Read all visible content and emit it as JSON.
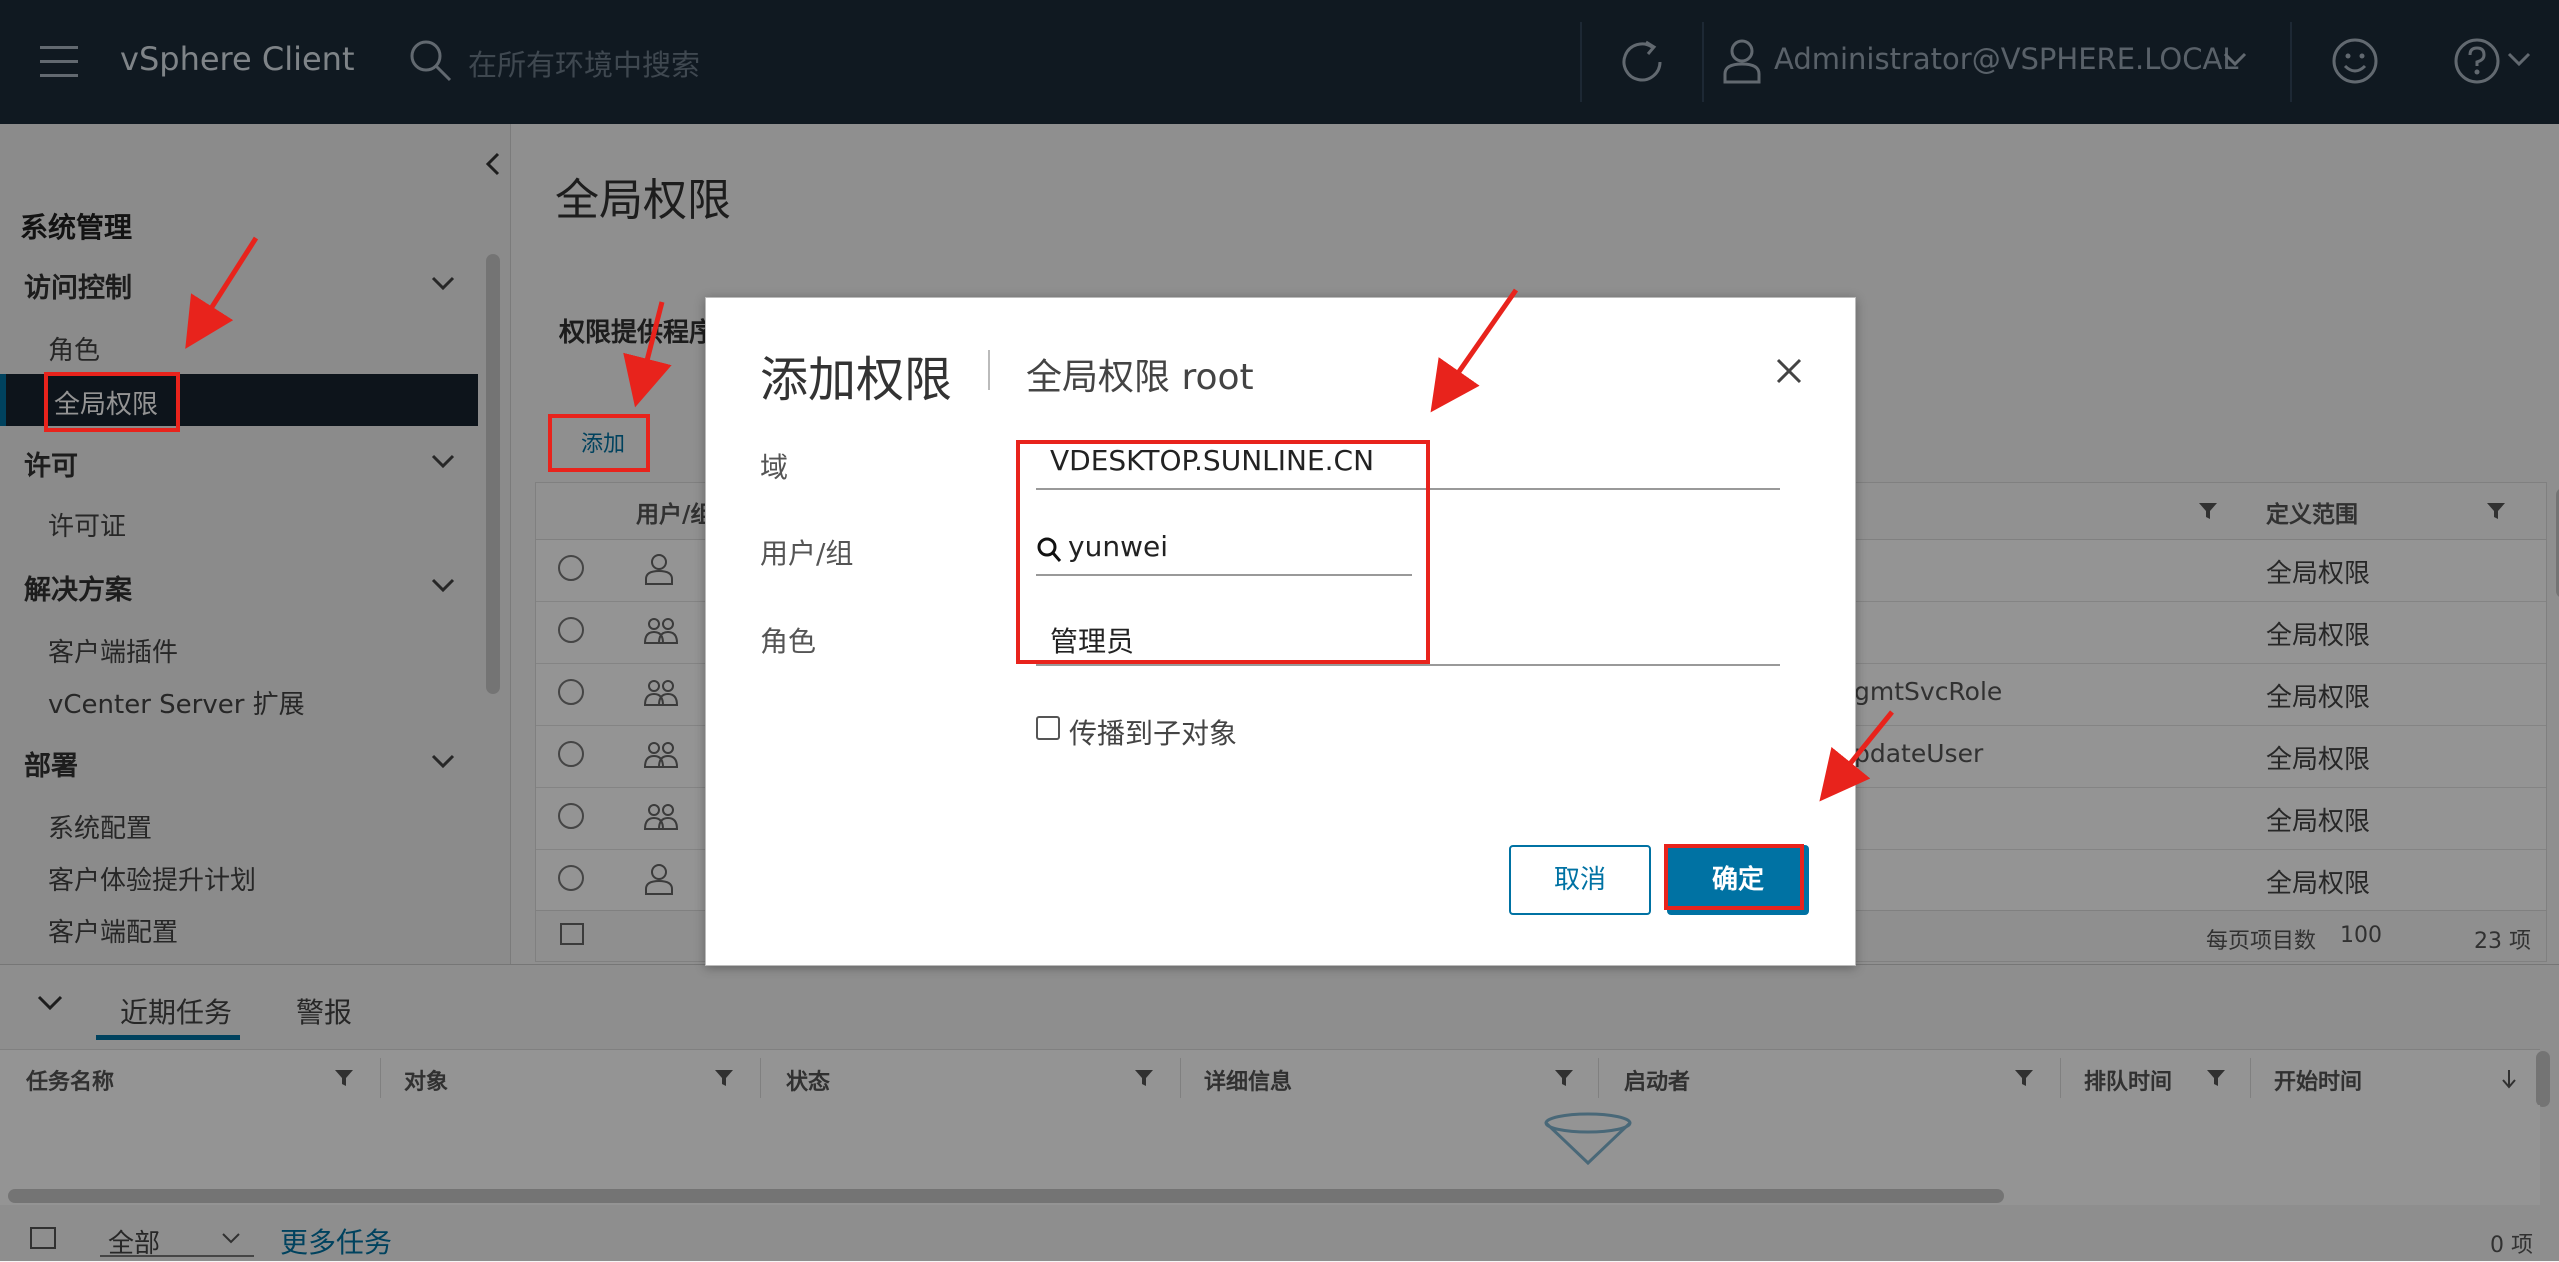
{
  "header": {
    "app_title": "vSphere Client",
    "search_placeholder": "在所有环境中搜索",
    "user": "Administrator@VSPHERE.LOCAL",
    "icons": [
      "menu-icon",
      "search-icon",
      "refresh-icon",
      "user-icon",
      "chevron-down-icon",
      "smile-icon",
      "help-icon"
    ]
  },
  "sidebar": {
    "header": "系统管理",
    "groups": [
      {
        "label": "访问控制",
        "items": [
          "角色",
          "全局权限"
        ]
      },
      {
        "label": "许可",
        "items": [
          "许可证"
        ]
      },
      {
        "label": "解决方案",
        "items": [
          "客户端插件",
          "vCenter Server 扩展"
        ]
      },
      {
        "label": "部署",
        "items": [
          "系统配置",
          "客户体验提升计划",
          "客户端配置"
        ]
      }
    ],
    "active_item": "全局权限"
  },
  "main": {
    "title": "全局权限",
    "provider_label": "权限提供程序",
    "add_label": "添加",
    "grid": {
      "col_user": "用户/组",
      "col_scope": "定义范围",
      "rows": [
        {
          "icon": "user-icon",
          "role": "",
          "scope": "全局权限"
        },
        {
          "icon": "group-icon",
          "role": "",
          "scope": "全局权限"
        },
        {
          "icon": "group-icon",
          "role": "gmtSvcRole",
          "scope": "全局权限"
        },
        {
          "icon": "group-icon",
          "role": "pdateUser",
          "scope": "全局权限"
        },
        {
          "icon": "group-icon",
          "role": "",
          "scope": "全局权限"
        },
        {
          "icon": "user-icon",
          "role": "",
          "scope": "全局权限"
        }
      ],
      "per_page_label": "每页项目数",
      "page_size": "100",
      "count": "23 项"
    }
  },
  "dialog": {
    "title": "添加权限",
    "subtitle": "全局权限 root",
    "domain_label": "域",
    "domain_value": "VDESKTOP.SUNLINE.CN",
    "user_label": "用户/组",
    "user_value": "yunwei",
    "role_label": "角色",
    "role_value": "管理员",
    "propagate_label": "传播到子对象",
    "propagate_checked": false,
    "cancel": "取消",
    "ok": "确定"
  },
  "tasks": {
    "tabs": [
      "近期任务",
      "警报"
    ],
    "active_tab": "近期任务",
    "columns": [
      "任务名称",
      "对象",
      "状态",
      "详细信息",
      "启动者",
      "排队时间",
      "开始时间"
    ],
    "filter": "全部",
    "more_tasks": "更多任务",
    "count": "0 项"
  },
  "colors": {
    "header_bg": "#1d2b3a",
    "accent": "#0072a3",
    "annotation": "#e8231c"
  }
}
